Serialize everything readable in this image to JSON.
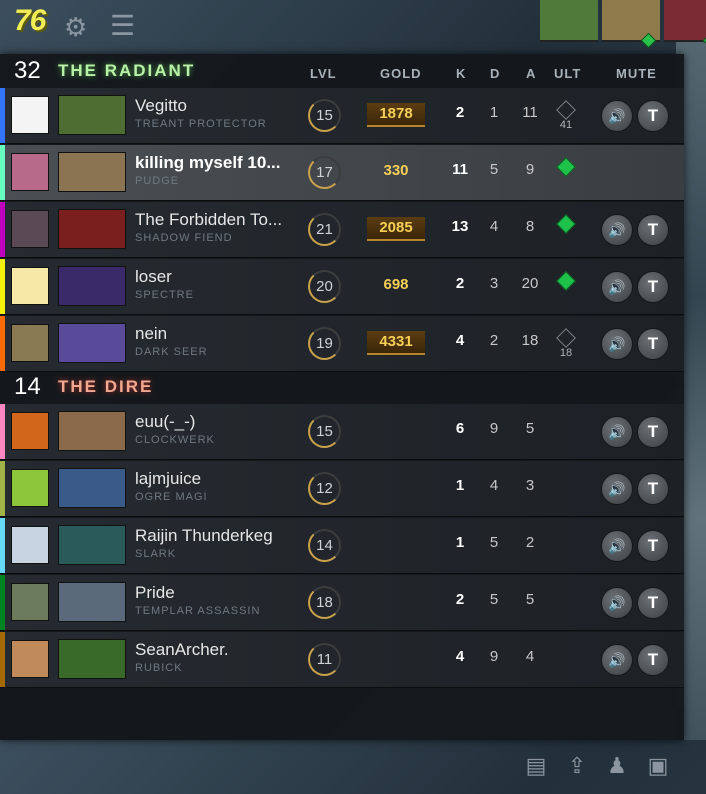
{
  "topbar": {
    "timer": "76",
    "icons": [
      "gear-icon",
      "menu-icon"
    ],
    "portrait_colors": [
      "#4f7a3a",
      "#8f7a4c",
      "#7a2b33"
    ]
  },
  "columns": {
    "lvl": "LVL",
    "gold": "GOLD",
    "k": "K",
    "d": "D",
    "a": "A",
    "ult": "ULT",
    "mute": "MUTE"
  },
  "radiant": {
    "score": "32",
    "name": "THE RADIANT",
    "players": [
      {
        "player": "Vegitto",
        "hero": "TREANT PROTECTOR",
        "level": "15",
        "gold": "1878",
        "k": "2",
        "d": "1",
        "a": "11",
        "ult": "cooldown",
        "ult_cd": "41",
        "color": "#3375ff",
        "avatar": "#f4f4f4",
        "hero_color": "#4d6d32"
      },
      {
        "player": "killing myself 10...",
        "hero": "PUDGE",
        "level": "17",
        "gold": "330",
        "k": "11",
        "d": "5",
        "a": "9",
        "ult": "ready",
        "ult_cd": "",
        "color": "#66ffbf",
        "avatar": "#b86a8a",
        "hero_color": "#8a7451"
      },
      {
        "player": "The Forbidden To...",
        "hero": "SHADOW FIEND",
        "level": "21",
        "gold": "2085",
        "k": "13",
        "d": "4",
        "a": "8",
        "ult": "ready",
        "ult_cd": "",
        "color": "#bf00bf",
        "avatar": "#5a4a55",
        "hero_color": "#7a1e1e"
      },
      {
        "player": "loser",
        "hero": "SPECTRE",
        "level": "20",
        "gold": "698",
        "k": "2",
        "d": "3",
        "a": "20",
        "ult": "ready",
        "ult_cd": "",
        "color": "#f3f00b",
        "avatar": "#f6e9a8",
        "hero_color": "#3b2a6a"
      },
      {
        "player": "nein",
        "hero": "DARK SEER",
        "level": "19",
        "gold": "4331",
        "k": "4",
        "d": "2",
        "a": "18",
        "ult": "cooldown",
        "ult_cd": "18",
        "color": "#ff6b00",
        "avatar": "#8a7a52",
        "hero_color": "#5a4a9a"
      }
    ]
  },
  "dire": {
    "score": "14",
    "name": "THE DIRE",
    "players": [
      {
        "player": "euu(-_-)",
        "hero": "CLOCKWERK",
        "level": "15",
        "k": "6",
        "d": "9",
        "a": "5",
        "color": "#fe86c2",
        "avatar": "#d2661a",
        "hero_color": "#8a6a4a"
      },
      {
        "player": "lajmjuice",
        "hero": "OGRE MAGI",
        "level": "12",
        "k": "1",
        "d": "4",
        "a": "3",
        "color": "#a1b447",
        "avatar": "#8cc63a",
        "hero_color": "#3a5a8a"
      },
      {
        "player": "Raijin Thunderkeg",
        "hero": "SLARK",
        "level": "14",
        "k": "1",
        "d": "5",
        "a": "2",
        "color": "#65d9f7",
        "avatar": "#c9d4e2",
        "hero_color": "#2a5a5a"
      },
      {
        "player": "Pride",
        "hero": "TEMPLAR ASSASSIN",
        "level": "18",
        "k": "2",
        "d": "5",
        "a": "5",
        "color": "#008321",
        "avatar": "#6a7a5a",
        "hero_color": "#5a6a7a"
      },
      {
        "player": "SeanArcher.",
        "hero": "RUBICK",
        "level": "11",
        "k": "4",
        "d": "9",
        "a": "4",
        "color": "#a46900",
        "avatar": "#c08a5a",
        "hero_color": "#3a6a2a"
      }
    ]
  },
  "bottom_icons": [
    "scoreboard-icon",
    "share-icon",
    "unit-control-icon",
    "shop-icon"
  ]
}
